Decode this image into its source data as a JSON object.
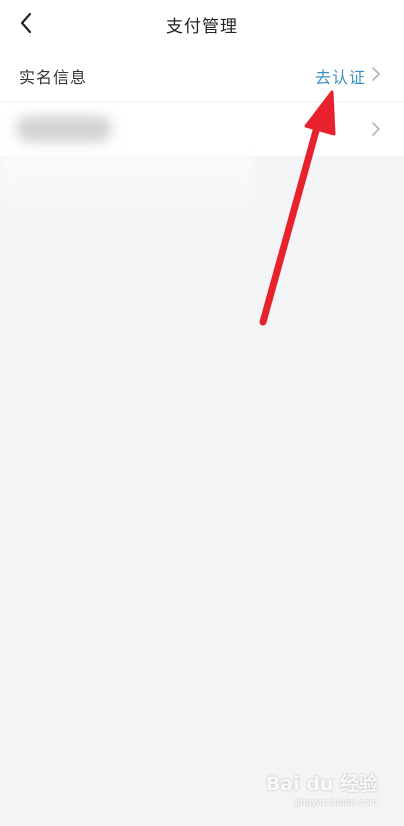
{
  "header": {
    "title": "支付管理"
  },
  "rows": {
    "realname": {
      "label": "实名信息",
      "action": "去认证"
    }
  },
  "icons": {
    "back": "back-arrow-icon",
    "chevron": "chevron-right-icon",
    "annotation": "red-arrow"
  },
  "colors": {
    "background": "#f3f4f6",
    "action_link": "#3e8fc0",
    "annotation_arrow": "#e8222c"
  },
  "watermark": {
    "brand": "Bai du 经验",
    "sub": "jingyan.baidu.com"
  }
}
